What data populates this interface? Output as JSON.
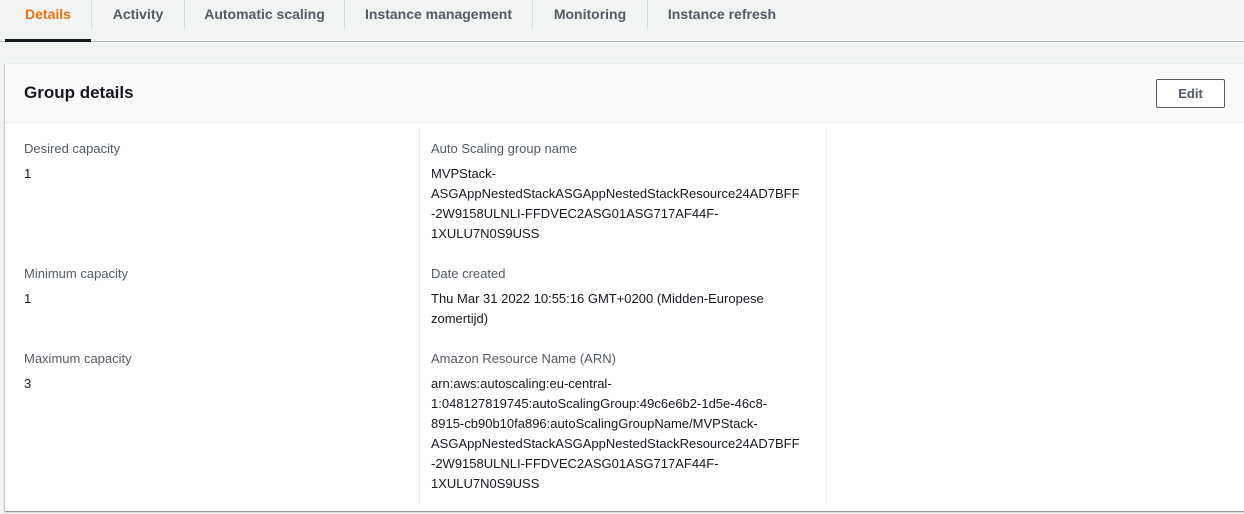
{
  "tabs": [
    {
      "label": "Details",
      "active": true
    },
    {
      "label": "Activity",
      "active": false
    },
    {
      "label": "Automatic scaling",
      "active": false
    },
    {
      "label": "Instance management",
      "active": false
    },
    {
      "label": "Monitoring",
      "active": false
    },
    {
      "label": "Instance refresh",
      "active": false
    }
  ],
  "panel": {
    "title": "Group details",
    "edit_label": "Edit"
  },
  "fields": {
    "desired_capacity": {
      "label": "Desired capacity",
      "value": "1"
    },
    "minimum_capacity": {
      "label": "Minimum capacity",
      "value": "1"
    },
    "maximum_capacity": {
      "label": "Maximum capacity",
      "value": "3"
    },
    "asg_name": {
      "label": "Auto Scaling group name",
      "lines": [
        "MVPStack-",
        "ASGAppNestedStackASGAppNestedStackResource24AD7BFF",
        "-2W9158ULNLI-FFDVEC2ASG01ASG717AF44F-",
        "1XULU7N0S9USS"
      ]
    },
    "date_created": {
      "label": "Date created",
      "lines": [
        "Thu Mar 31 2022 10:55:16 GMT+0200 (Midden-Europese",
        "zomertijd)"
      ]
    },
    "arn": {
      "label": "Amazon Resource Name (ARN)",
      "lines": [
        "arn:aws:autoscaling:eu-central-",
        "1:048127819745:autoScalingGroup:49c6e6b2-1d5e-46c8-",
        "8915-cb90b10fa896:autoScalingGroupName/MVPStack-",
        "ASGAppNestedStackASGAppNestedStackResource24AD7BFF",
        "-2W9158ULNLI-FFDVEC2ASG01ASG717AF44F-",
        "1XULU7N0S9USS"
      ]
    }
  },
  "colors": {
    "accent": "#ec7211",
    "text": "#16191f",
    "muted": "#545b64",
    "background": "#f2f3f3"
  }
}
